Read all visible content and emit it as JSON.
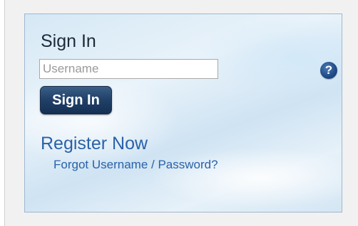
{
  "signin": {
    "title": "Sign In",
    "username_placeholder": "Username",
    "username_value": "",
    "button_label": "Sign In",
    "help_glyph": "?",
    "register_link": "Register Now",
    "forgot_link": "Forgot Username / Password?"
  },
  "icons": {
    "help": "question-circle-icon"
  },
  "colors": {
    "link": "#2a62a8",
    "button": "#22426a",
    "help_icon": "#1f4a86",
    "panel_border": "#9fb8cf"
  }
}
